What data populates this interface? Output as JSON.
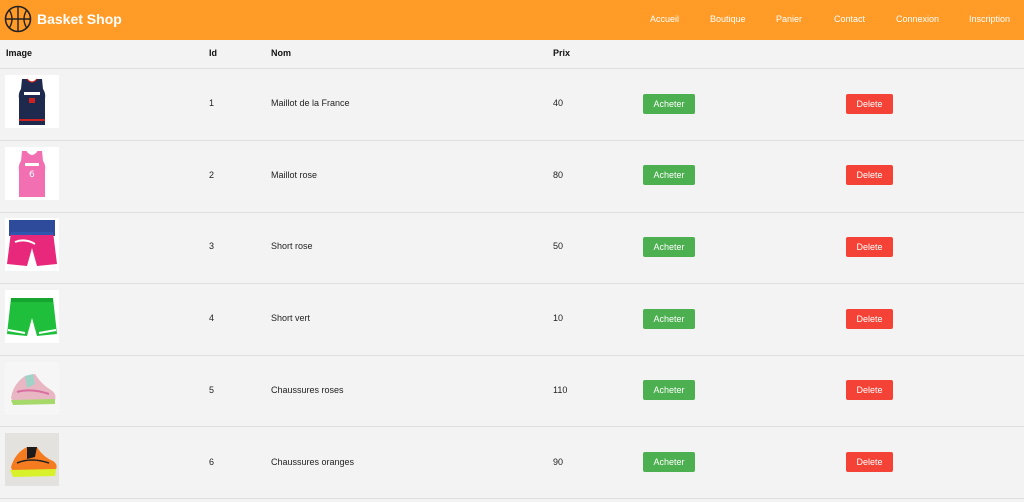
{
  "brand": {
    "name": "Basket Shop",
    "logo_icon": "basketball-icon"
  },
  "nav": {
    "items": [
      "Accueil",
      "Boutique",
      "Panier",
      "Contact",
      "Connexion",
      "Inscription"
    ]
  },
  "colors": {
    "header": "#ff9b26",
    "buy_button": "#4caf50",
    "delete_button": "#f44336",
    "background": "#f3f3f3"
  },
  "table": {
    "headers": {
      "image": "Image",
      "id": "Id",
      "name": "Nom",
      "price": "Prix"
    },
    "buy_label": "Acheter",
    "delete_label": "Delete",
    "rows": [
      {
        "id": "1",
        "name": "Maillot de la France",
        "price": "40",
        "image": "navy-jersey-image"
      },
      {
        "id": "2",
        "name": "Maillot rose",
        "price": "80",
        "image": "pink-jersey-image"
      },
      {
        "id": "3",
        "name": "Short rose",
        "price": "50",
        "image": "pink-shorts-image"
      },
      {
        "id": "4",
        "name": "Short vert",
        "price": "10",
        "image": "green-shorts-image"
      },
      {
        "id": "5",
        "name": "Chaussures roses",
        "price": "110",
        "image": "pink-sneaker-image"
      },
      {
        "id": "6",
        "name": "Chaussures oranges",
        "price": "90",
        "image": "orange-sneaker-image"
      }
    ]
  }
}
